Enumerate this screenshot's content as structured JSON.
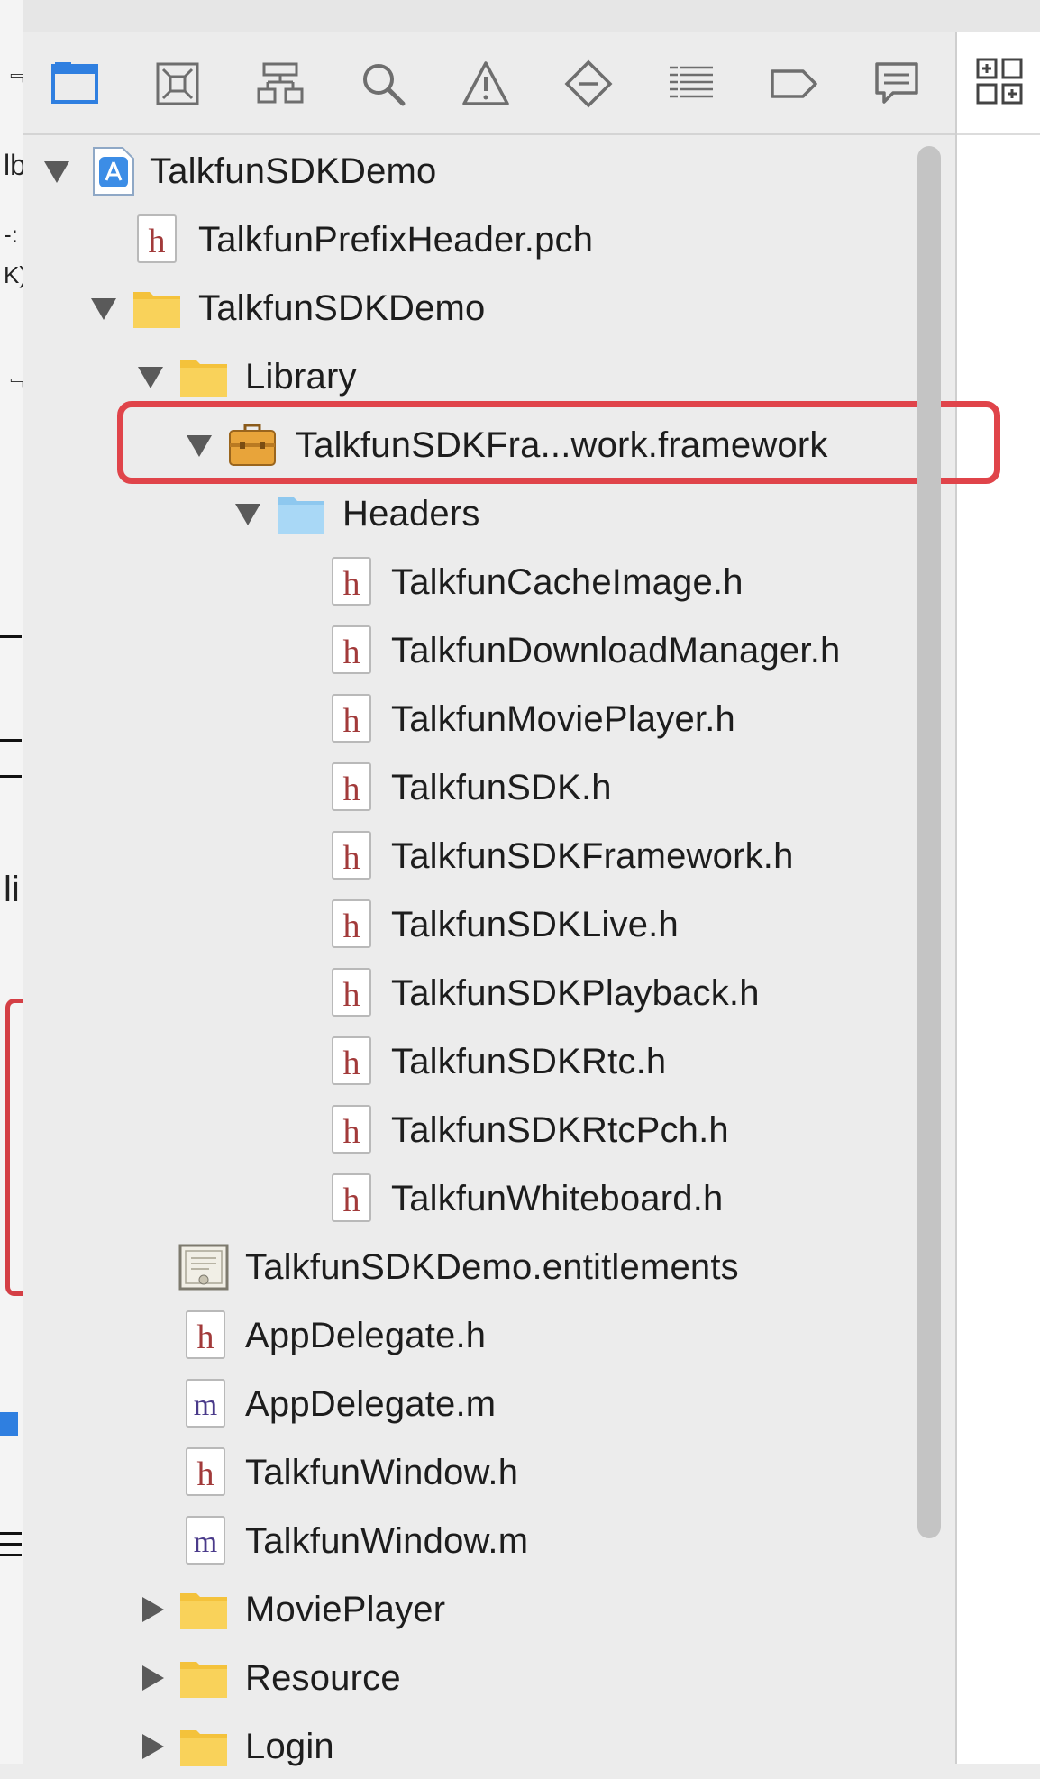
{
  "toolbar": {
    "icons": [
      "folder-icon",
      "source-control-icon",
      "hierarchy-icon",
      "search-icon",
      "warning-icon",
      "breakpoint-diamond-icon",
      "list-icon",
      "tag-icon",
      "comment-icon"
    ],
    "accent": "#2f7fe0"
  },
  "inspector": {
    "icon": "library-grid-icon"
  },
  "tree": {
    "root": "TalkfunSDKDemo",
    "prefix_header": "TalkfunPrefixHeader.pch",
    "group": "TalkfunSDKDemo",
    "library": "Library",
    "framework": "TalkfunSDKFra...work.framework",
    "headers": "Headers",
    "header_files": [
      "TalkfunCacheImage.h",
      "TalkfunDownloadManager.h",
      "TalkfunMoviePlayer.h",
      "TalkfunSDK.h",
      "TalkfunSDKFramework.h",
      "TalkfunSDKLive.h",
      "TalkfunSDKPlayback.h",
      "TalkfunSDKRtc.h",
      "TalkfunSDKRtcPch.h",
      "TalkfunWhiteboard.h"
    ],
    "entitlements": "TalkfunSDKDemo.entitlements",
    "app_delegate_h": "AppDelegate.h",
    "app_delegate_m": "AppDelegate.m",
    "window_h": "TalkfunWindow.h",
    "window_m": "TalkfunWindow.m",
    "movie_player": "MoviePlayer",
    "resource": "Resource",
    "login": "Login",
    "file_letters": {
      "header": "h",
      "impl": "m"
    }
  },
  "highlight_color": "#e0444a",
  "left_strip_glyphs": [
    "﹃",
    "lb",
    "-:",
    "K)",
    "﹃",
    "li"
  ]
}
